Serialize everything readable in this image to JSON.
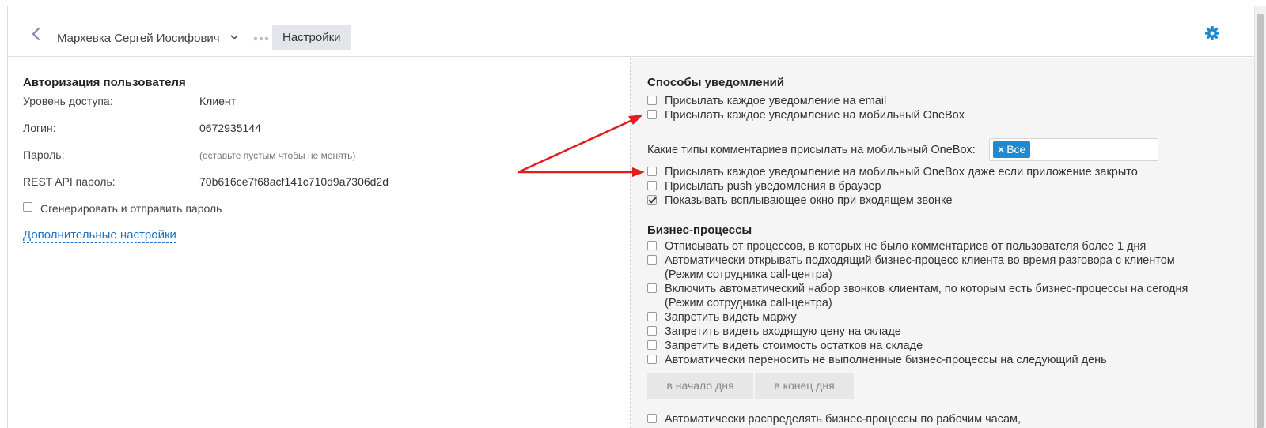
{
  "header": {
    "user_name": "Мархевка Сергей Иосифович",
    "breadcrumb_active": "Настройки",
    "accent_color": "#1f8ad0"
  },
  "auth": {
    "title": "Авторизация пользователя",
    "access_level_label": "Уровень доступа:",
    "access_level_value": "Клиент",
    "login_label": "Логин:",
    "login_value": "0672935144",
    "password_label": "Пароль:",
    "password_hint": "(оставьте пустым чтобы не менять)",
    "rest_label": "REST API пароль:",
    "rest_value": "70b616ce7f68acf141c710d9a7306d2d",
    "generate_label": "Сгенерировать и отправить пароль",
    "generate_checked": false,
    "more_settings_link": "Дополнительные настройки"
  },
  "notifications": {
    "title": "Способы уведомлений",
    "email": {
      "label": "Присылать каждое уведомление на email",
      "checked": false
    },
    "mobile": {
      "label": "Присылать каждое уведомление на мобильный OneBox",
      "checked": false
    },
    "comment_types_label": "Какие типы комментариев присылать на мобильный OneBox:",
    "comment_types_tag": "Все",
    "mobile_closed": {
      "label": "Присылать каждое уведомление на мобильный OneBox даже если приложение закрыто",
      "checked": false
    },
    "push": {
      "label": "Присылать push уведомления в браузер",
      "checked": false
    },
    "popup": {
      "label": "Показывать всплывающее окно при входящем звонке",
      "checked": true
    }
  },
  "business": {
    "title": "Бизнес-процессы",
    "unsubscribe": {
      "label": "Отписывать от процессов, в которых не было комментариев от пользователя более 1 дня",
      "checked": false
    },
    "auto_open": {
      "label": "Автоматически открывать подходящий бизнес-процесс клиента во время разговора с клиентом",
      "label2": "(Режим сотрудника call-центра)",
      "checked": false
    },
    "auto_dial": {
      "label": "Включить автоматический набор звонков клиентам, по которым есть бизнес-процессы на сегодня",
      "label2": "(Режим сотрудника call-центра)",
      "checked": false
    },
    "no_margin": {
      "label": "Запретить видеть маржу",
      "checked": false
    },
    "no_incoming_price": {
      "label": "Запретить видеть входящую цену на складе",
      "checked": false
    },
    "no_stock_cost": {
      "label": "Запретить видеть стоимость остатков на складе",
      "checked": false
    },
    "auto_move": {
      "label": "Автоматически переносить не выполненные бизнес-процессы на следующий день",
      "checked": false
    },
    "day_start": "в начало дня",
    "day_end": "в конец дня",
    "auto_distribute": {
      "label": "Автоматически распределять бизнес-процессы по рабочим часам,",
      "checked": false
    }
  }
}
